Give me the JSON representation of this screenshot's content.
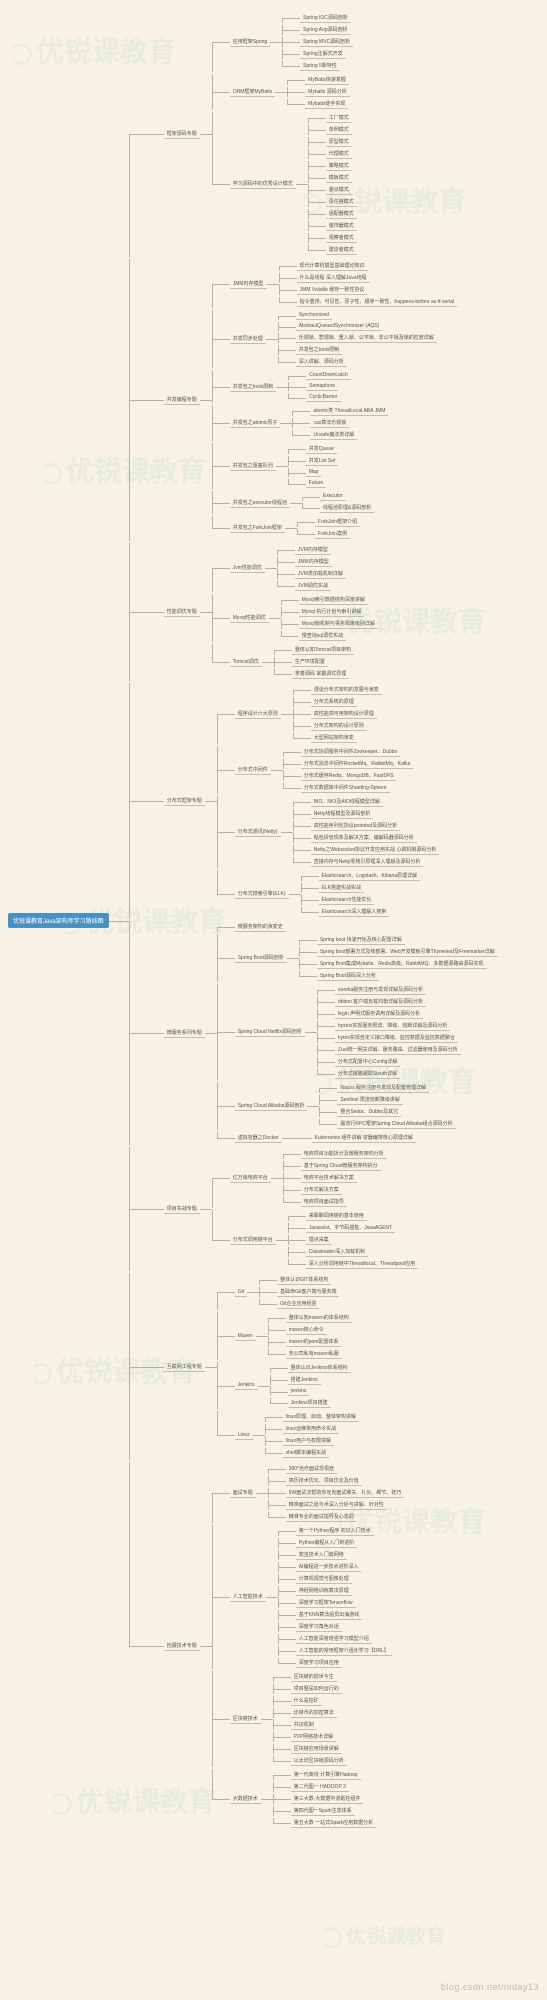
{
  "root": "优锐课教育Java架构师学习路线图",
  "watermark": "优锐课教育",
  "footer": "blog.csdn.net/niday13",
  "topics": [
    {
      "name": "框架源码专题",
      "children": [
        {
          "name": "应用框架Spring",
          "children": [
            {
              "name": "Spring IOC源码剖析"
            },
            {
              "name": "Spring Aop源码剖析"
            },
            {
              "name": "Spring MVC源码剖析"
            },
            {
              "name": "Spring注解式开发"
            },
            {
              "name": "Spring 5新特性"
            }
          ]
        },
        {
          "name": "ORM框架MyBatis",
          "children": [
            {
              "name": "MyBatis快速掌握"
            },
            {
              "name": "Mybatis 源码分析"
            },
            {
              "name": "Mybatis徒手实现"
            }
          ]
        },
        {
          "name": "学习源码中的优秀设计模式",
          "children": [
            {
              "name": "工厂模式"
            },
            {
              "name": "单例模式"
            },
            {
              "name": "原型模式"
            },
            {
              "name": "代理模式"
            },
            {
              "name": "策略模式"
            },
            {
              "name": "模板模式"
            },
            {
              "name": "委派模式"
            },
            {
              "name": "责任链模式"
            },
            {
              "name": "适配器模式"
            },
            {
              "name": "装饰器模式"
            },
            {
              "name": "观察者模式"
            },
            {
              "name": "建造者模式"
            }
          ]
        }
      ]
    },
    {
      "name": "并发编程专题",
      "children": [
        {
          "name": "JMM内存模型",
          "children": [
            {
              "name": "现代计算机模型基础理论知识"
            },
            {
              "name": "什么是线程 深入理解Java线程"
            },
            {
              "name": "JMM Volatile 缓存一致性协议"
            },
            {
              "name": "指令重排、可见性、原子性、顺序一致性、happens-before as-if-serial"
            }
          ]
        },
        {
          "name": "并发同步处理",
          "children": [
            {
              "name": "Synchronized"
            },
            {
              "name": "AbstractQueuedSynchronizer (AQS)"
            },
            {
              "name": "乐观锁、悲观锁、重入锁、公平锁、非公平锁及锁的粒度详解"
            },
            {
              "name": "并发包之tools限制"
            },
            {
              "name": "深入讲解、源码分析"
            }
          ]
        },
        {
          "name": "并发包之tools限制",
          "children": [
            {
              "name": "CountDownLatch"
            },
            {
              "name": "Semaphore"
            },
            {
              "name": "CyclicBarrier"
            }
          ]
        },
        {
          "name": "并发包之atomic原子",
          "children": [
            {
              "name": "atomic类 ThreadLocal ABA JMM"
            },
            {
              "name": "cas算法乐观锁"
            },
            {
              "name": "Unsafe魔法类详解"
            }
          ]
        },
        {
          "name": "并发包之阻塞队列",
          "children": [
            {
              "name": "并发Queue"
            },
            {
              "name": "并发List Set"
            },
            {
              "name": "Map"
            },
            {
              "name": "Future"
            }
          ]
        },
        {
          "name": "并发包之executor线程池",
          "children": [
            {
              "name": "Executor"
            },
            {
              "name": "线程池原理&源码剖析"
            }
          ]
        },
        {
          "name": "并发包之ForkJoin框架",
          "children": [
            {
              "name": "ForkJoin框架介绍"
            },
            {
              "name": "ForkJoin案例"
            }
          ]
        }
      ]
    },
    {
      "name": "性能调优专题",
      "children": [
        {
          "name": "Jvm性能调优",
          "children": [
            {
              "name": "JVM内存模型"
            },
            {
              "name": "JMM内存模型"
            },
            {
              "name": "JVM类加载机制详解"
            },
            {
              "name": "JVM调优实战"
            }
          ]
        },
        {
          "name": "Mysql性能调优",
          "children": [
            {
              "name": "Mysql索引数据结构深度讲解"
            },
            {
              "name": "Mysql 执行计划与索引讲解"
            },
            {
              "name": "Mysql锁机制与事务隔离级别详解"
            },
            {
              "name": "慢查询sql调优实战"
            }
          ]
        },
        {
          "name": "Tomcat调优",
          "children": [
            {
              "name": "整体认知Tomcat项目架构"
            },
            {
              "name": "生产环境配置"
            },
            {
              "name": "拿着源码 掌握调优原理"
            }
          ]
        }
      ]
    },
    {
      "name": "分布式框架专题",
      "children": [
        {
          "name": "程序设计六大原则",
          "children": [
            {
              "name": "漫谈分布式架构的发展与演变"
            },
            {
              "name": "分布式系统的原理"
            },
            {
              "name": "高性能高可用架构设计原理"
            },
            {
              "name": "分布式架构的设计原则"
            },
            {
              "name": "大型网站架构演变"
            }
          ]
        },
        {
          "name": "分布式中间件",
          "children": [
            {
              "name": "分布式协调服务中间件Zookeeper、Dubbo"
            },
            {
              "name": "分布式消息中间件RocketMq、RabbitMq、Kafka"
            },
            {
              "name": "分布式缓存Redis、MongoDB、FastDFS"
            },
            {
              "name": "分布式数据库中间件Sharding-Sphere"
            }
          ]
        },
        {
          "name": "分布式通讯(Netty)",
          "children": [
            {
              "name": "BIO、NIO及AIO线程模型详解"
            },
            {
              "name": "Netty线程模型及源码剖析"
            },
            {
              "name": "高性能序列化协议protobuf及源码分析"
            },
            {
              "name": "粘包拆包现象及解决方案、编解码器源码分析"
            },
            {
              "name": "Netty之Websocket协议开发应用实战 心跳机制源码分析"
            },
            {
              "name": "直接内存与Netty零拷贝原理深入理解及源码分析"
            }
          ]
        },
        {
          "name": "分布式搜索引擎(ELK)",
          "children": [
            {
              "name": "Elasticsearch、Logstash、Kibana原理详解"
            },
            {
              "name": "ELK搭建实战实战"
            },
            {
              "name": "Elasticsearch性能优化"
            },
            {
              "name": "Elasticsearch深入理解入搜索"
            }
          ]
        }
      ]
    },
    {
      "name": "微服务系列专题",
      "children": [
        {
          "name": "微服务架构的演变史"
        },
        {
          "name": "Spring Boot源码剖析",
          "children": [
            {
              "name": "Spring boot 快速开始及核心配置详解"
            },
            {
              "name": "Spring boot部署方式及热部署、Web开发模板引擎Thymeleaf及Freemarker详解"
            },
            {
              "name": "Spring Boot集成Mybatis、Redis高级、RabbitMQ、多数据源路由源码实现"
            },
            {
              "name": "Spring Boot源码深入分析"
            }
          ]
        },
        {
          "name": "Spring Cloud Netflix源码剖析",
          "children": [
            {
              "name": "eureka服务注册与发现详解及源码分析"
            },
            {
              "name": "ribbon 客户端负载均衡详解及源码分析"
            },
            {
              "name": "fegin 声明式服务调用详解及源码分析"
            },
            {
              "name": "hystrix实现服务限流、降级、熔断详解及源码分析"
            },
            {
              "name": "hytrix实现自定义接口降级、监控数据及监控数据聚合"
            },
            {
              "name": "Zuul统一网关详解、服务路由、过滤器使用及源码分析"
            },
            {
              "name": "分布式配置中心Config详解"
            },
            {
              "name": "分布式链路跟踪Sleuth详解"
            }
          ]
        },
        {
          "name": "Spring Cloud Alibaba源码剖析",
          "children": [
            {
              "name": "Nacos 服务注册与发现及配置管理详解"
            },
            {
              "name": "Sentinel 限流熔断降级讲解"
            },
            {
              "name": "整合Seata、Dubbo及其它"
            },
            {
              "name": "最流行RPC框架Spring Cloud Alibaba组合源码分析"
            }
          ]
        },
        {
          "name": "虚拟容器之Docker",
          "children": [
            {
              "name": "Kubernetes 组件讲解 容器编排核心原理详解"
            }
          ]
        }
      ]
    },
    {
      "name": "项目实战专题",
      "children": [
        {
          "name": "亿万级电商平台",
          "children": [
            {
              "name": "电商项目功能拆分及微服务架构分析"
            },
            {
              "name": "基于Spring Cloud微服务架构拆分"
            },
            {
              "name": "电商平台技术解决方案"
            },
            {
              "name": "分布式解决方案"
            },
            {
              "name": "电商项目面试指导"
            }
          ]
        },
        {
          "name": "分布式调用链平台",
          "children": [
            {
              "name": "来聊聊调用链的基本使用"
            },
            {
              "name": "Javassist、字节码插桩、JavaAGENT"
            },
            {
              "name": "埋点采集"
            },
            {
              "name": "Classloader深入加载机制"
            },
            {
              "name": "深入分析调用链中Threadlocal、Threadpool应用"
            }
          ]
        }
      ]
    },
    {
      "name": "互联网工程专题",
      "children": [
        {
          "name": "Git",
          "children": [
            {
              "name": "整体认识GIT体系结构"
            },
            {
              "name": "基础命Git客户端与服务端"
            },
            {
              "name": "Git企业应用经验"
            }
          ]
        },
        {
          "name": "Maven",
          "children": [
            {
              "name": "整体认知maven的体系结构"
            },
            {
              "name": "maven核心命令"
            },
            {
              "name": "maven的pom配置体系"
            },
            {
              "name": "务公司私有maven私服"
            }
          ]
        },
        {
          "name": "Jenkins",
          "children": [
            {
              "name": "整体认识Jenkins体系结构"
            },
            {
              "name": "搭建Jenkins"
            },
            {
              "name": "jenkins"
            },
            {
              "name": "Jenkins项目搭建"
            }
          ]
        },
        {
          "name": "Linux",
          "children": [
            {
              "name": "linux原理、启动、整体架构讲解"
            },
            {
              "name": "linux运维常用命令实战"
            },
            {
              "name": "linux用户与权限讲解"
            },
            {
              "name": "shell脚本编程实战"
            }
          ]
        }
      ]
    },
    {
      "name": "拓展技术专题",
      "children": [
        {
          "name": "面试专题",
          "children": [
            {
              "name": "360°治疗面试恐惧症"
            },
            {
              "name": "简历技术优化、项目优化及价值"
            },
            {
              "name": "5W面试法帮助你攻克面试难关、礼仪、细节、技巧"
            },
            {
              "name": "精准面试之道与术深入分析与讲解、针对性"
            },
            {
              "name": "精准专业的面试指导及心态调"
            }
          ]
        },
        {
          "name": "人工智能技术",
          "children": [
            {
              "name": "第一个Python程序 初识入门技术"
            },
            {
              "name": "Python编程从入门到进阶"
            },
            {
              "name": "爬虫技术入门篇网络"
            },
            {
              "name": "AI编程进一步技术进阶深入"
            },
            {
              "name": "计算机视觉与图像处理"
            },
            {
              "name": "神经网络训练算法原理"
            },
            {
              "name": "深度学习框架Tensorflow"
            },
            {
              "name": "基于KNN算法船员出海游戏"
            },
            {
              "name": "深度学习角色对话"
            },
            {
              "name": "人工智能深度增强学习模型介绍"
            },
            {
              "name": "人工智能的常用框架介强化学习【DRL】"
            },
            {
              "name": "深度学习项目应用"
            }
          ]
        },
        {
          "name": "区块链技术",
          "children": [
            {
              "name": "区块链的前世今生"
            },
            {
              "name": "项目整是如何运行的"
            },
            {
              "name": "什么是挖矿"
            },
            {
              "name": "比特币的加密算法"
            },
            {
              "name": "共识机制"
            },
            {
              "name": "P2P网络技术详解"
            },
            {
              "name": "区块链应用场景讲解"
            },
            {
              "name": "以太坊区块链源码分析"
            }
          ]
        },
        {
          "name": "大数据技术",
          "children": [
            {
              "name": "第一代离线 计算引擎Hadoop"
            },
            {
              "name": "第二代图一 HADOOP 2"
            },
            {
              "name": "第三大数-大数据中流砥柱组件"
            },
            {
              "name": "第四代图一Spark生态体系"
            },
            {
              "name": "第五大数 一站式Spark应用数据分析"
            }
          ]
        }
      ]
    }
  ]
}
